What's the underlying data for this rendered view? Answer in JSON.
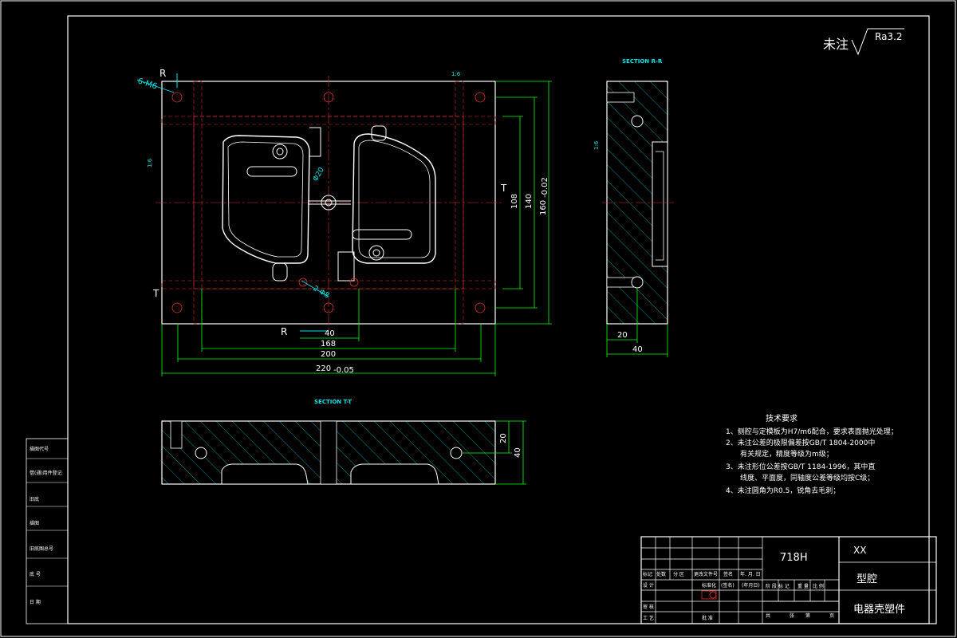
{
  "surface": {
    "label": "未注",
    "value": "Ra3.2"
  },
  "sections": {
    "rr": "SECTION R-R",
    "tt": "SECTION T-T"
  },
  "cut_labels": {
    "r": "R",
    "t": "T"
  },
  "callouts": {
    "holes": "6-M6",
    "dia20": "Φ20",
    "dia8": "2-Φ8",
    "slope": "1:6"
  },
  "dims": {
    "d40": "40",
    "d168": "168",
    "d200": "200",
    "d220": "220",
    "d220_tol": "-0.05",
    "d108": "108",
    "d140": "140",
    "d160": "160",
    "d160_tol": "-0.02",
    "side20": "20",
    "side40": "40",
    "tt20": "20",
    "tt40": "40"
  },
  "notes": {
    "title": "技术要求",
    "items": [
      "1、侧腔与定模板为H7/m6配合，要求表面抛光处理；",
      "2、未注公差的极限偏差按GB/T 1804-2000中",
      "有关规定，精度等级为m级；",
      "3、未注形位公差按GB/T 1184-1996，其中直",
      "线度、平面度，同轴度公差等级均按C级；",
      "4、未注圆角为R0.5，锐角去毛刺；"
    ]
  },
  "left_strip": [
    "描图代号",
    "",
    "借(通)用件登记",
    "旧底",
    "描图",
    "旧底图总号",
    "底 号",
    "日 期"
  ],
  "title_block": {
    "material": "718H",
    "company": "XX",
    "part_type": "型腔",
    "part_name": "电器壳塑件",
    "headers": [
      "标记",
      "处数",
      "分 区",
      "更改文件号",
      "签名",
      "年. 月. 日"
    ],
    "rows": [
      "设 计",
      "",
      "",
      "审 核",
      "工 艺"
    ],
    "standard_label": "标准化",
    "signature": "(签名)",
    "date": "(年月日)",
    "approve": "批 准",
    "stage_labels": [
      "阶 段 标 记",
      "重 量",
      "比 例"
    ],
    "sheet_labels": [
      "共",
      "张",
      "第",
      "页"
    ]
  }
}
